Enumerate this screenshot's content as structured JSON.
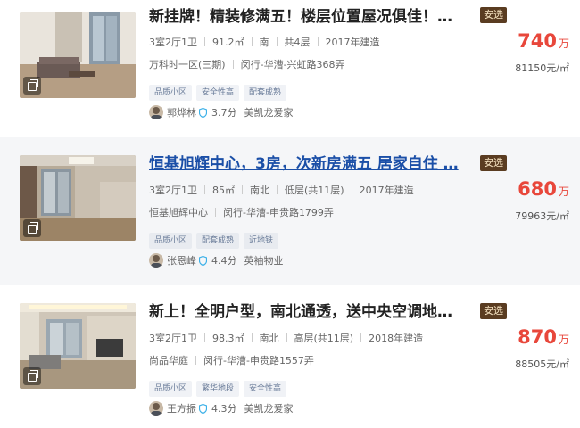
{
  "listings": [
    {
      "title": "新挂牌！精装修满五！楼层位置屋况俱佳！…",
      "tag": "安选",
      "layout": "3室2厅1卫",
      "area": "91.2㎡",
      "orientation": "南",
      "floor": "共4层",
      "year": "2017年建造",
      "community": "万科时一区(三期)",
      "location": "闵行-华漕-兴虹路368弄",
      "chips": [
        "品质小区",
        "安全性高",
        "配套成熟"
      ],
      "agent": "郭烨林",
      "score": "3.7分",
      "company": "美凯龙爱家",
      "price": "740",
      "price_unit": "万",
      "unit_price": "81150元/㎡"
    },
    {
      "title": "恒基旭辉中心，3房，次新房满五 居家自住 …",
      "tag": "安选",
      "layout": "3室2厅1卫",
      "area": "85㎡",
      "orientation": "南北",
      "floor": "低层(共11层)",
      "year": "2017年建造",
      "community": "恒基旭辉中心",
      "location": "闵行-华漕-申贵路1799弄",
      "chips": [
        "品质小区",
        "配套成熟",
        "近地铁"
      ],
      "agent": "张恩峰",
      "score": "4.4分",
      "company": "英袖物业",
      "price": "680",
      "price_unit": "万",
      "unit_price": "79963元/㎡"
    },
    {
      "title": "新上！全明户型，南北通透，送中央空调地…",
      "tag": "安选",
      "layout": "3室2厅1卫",
      "area": "98.3㎡",
      "orientation": "南北",
      "floor": "高层(共11层)",
      "year": "2018年建造",
      "community": "尚品华庭",
      "location": "闵行-华漕-申贵路1557弄",
      "chips": [
        "品质小区",
        "繁华地段",
        "安全性高"
      ],
      "agent": "王方振",
      "score": "4.3分",
      "company": "美凯龙爱家",
      "price": "870",
      "price_unit": "万",
      "unit_price": "88505元/㎡"
    }
  ],
  "colors": {
    "price": "#e8473b",
    "tag_bg": "#5a3c21",
    "link": "#1b4fa7",
    "shield": "#3bb0e8"
  },
  "icons": {
    "photo_badge": "album-icon",
    "verified": "shield-icon"
  }
}
